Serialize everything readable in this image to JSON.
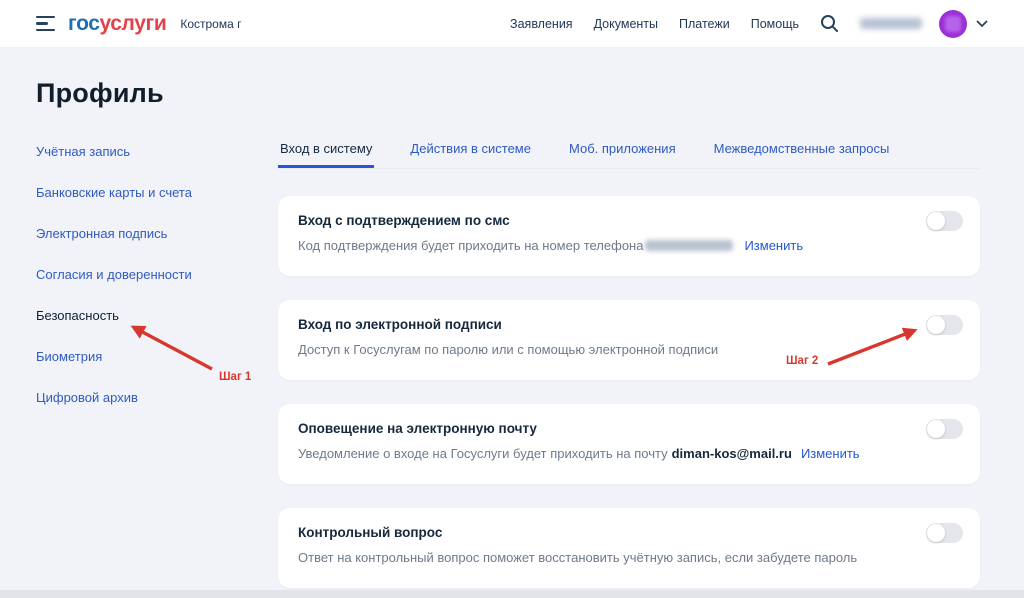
{
  "header": {
    "logo_part1": "гос",
    "logo_part2": "услуги",
    "region": "Кострома г",
    "nav": [
      {
        "label": "Заявления"
      },
      {
        "label": "Документы"
      },
      {
        "label": "Платежи"
      },
      {
        "label": "Помощь"
      }
    ],
    "icons": {
      "menu": "hamburger-3-lines",
      "search": "magnifier",
      "avatar": "purple-circle-user",
      "chevron": "chevron-down"
    },
    "username_state": "blurred"
  },
  "page": {
    "title": "Профиль"
  },
  "sidebar": {
    "items": [
      {
        "label": "Учётная запись",
        "active": false
      },
      {
        "label": "Банковские карты и счета",
        "active": false
      },
      {
        "label": "Электронная подпись",
        "active": false
      },
      {
        "label": "Согласия и доверенности",
        "active": false
      },
      {
        "label": "Безопасность",
        "active": true
      },
      {
        "label": "Биометрия",
        "active": false
      },
      {
        "label": "Цифровой архив",
        "active": false
      }
    ]
  },
  "tabs": [
    {
      "label": "Вход в систему",
      "active": true
    },
    {
      "label": "Действия в системе",
      "active": false
    },
    {
      "label": "Моб. приложения",
      "active": false
    },
    {
      "label": "Межведомственные запросы",
      "active": false
    }
  ],
  "cards": [
    {
      "title": "Вход с подтверждением по смс",
      "desc": "Код подтверждения будет приходить на номер телефона",
      "blurred_value": "phone-number",
      "link": "Изменить",
      "toggle": "off"
    },
    {
      "title": "Вход по электронной подписи",
      "desc": "Доступ к Госуслугам по паролю или с помощью электронной подписи",
      "toggle": "off"
    },
    {
      "title": "Оповещение на электронную почту",
      "desc": "Уведомление о входе на Госуслуги будет приходить на почту",
      "email": "diman-kos@mail.ru",
      "link": "Изменить",
      "toggle": "off"
    },
    {
      "title": "Контрольный вопрос",
      "desc": "Ответ на контрольный вопрос поможет восстановить учётную запись, если забудете пароль",
      "toggle": "off"
    }
  ],
  "annotations": {
    "step1": "Шаг 1",
    "step2": "Шаг 2",
    "arrow_color": "#d8372f"
  },
  "colors": {
    "page_bg": "#f1f3f8",
    "accent_blue": "#2f5bc2",
    "link_blue": "#2456d6",
    "active_tab_underline": "#2456d6",
    "logo_blue": "#1e6db6",
    "logo_red": "#e8404b",
    "dark_text": "#16283d",
    "desc_gray": "#6e7a8c",
    "toggle_track": "#e5e6eb",
    "avatar_purple": "#9c2fd6",
    "arrow_red": "#d8372f"
  }
}
